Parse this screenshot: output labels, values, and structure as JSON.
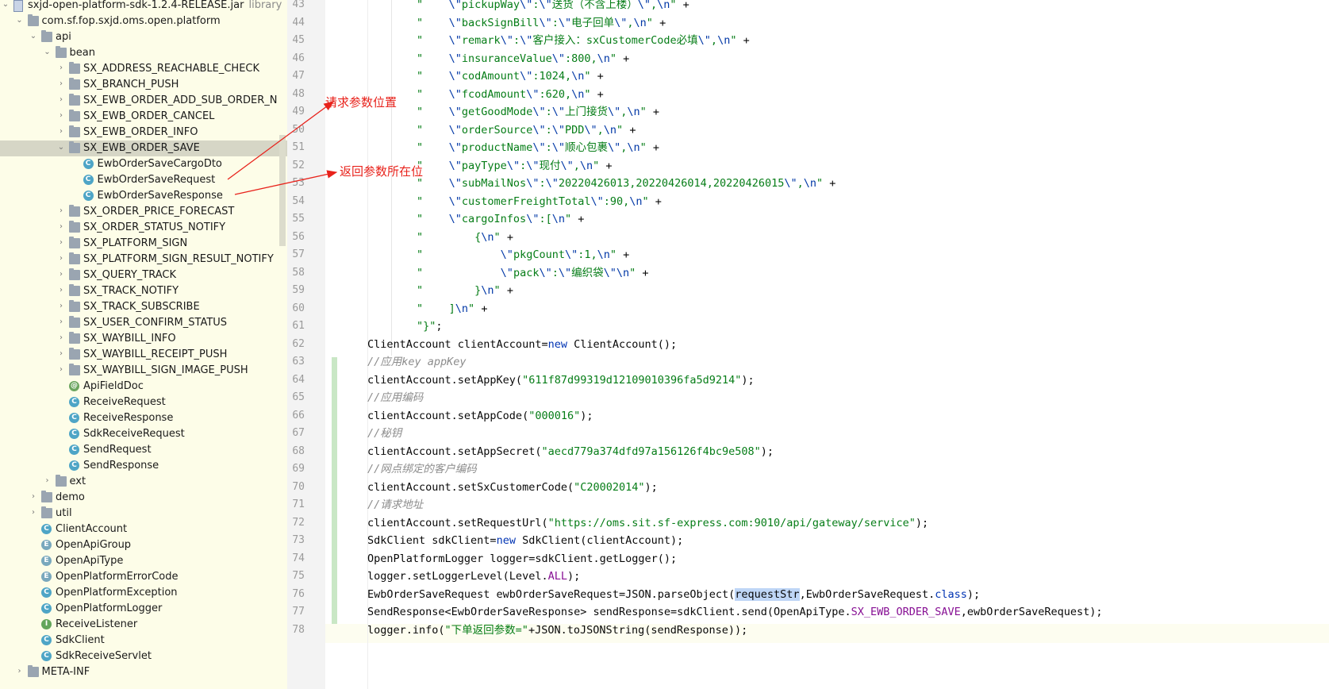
{
  "tree": {
    "rows": [
      {
        "depth": 2,
        "expanded": true,
        "icon": "jar",
        "label": "sxjd-open-platform-sdk-1.2.4-RELEASE.jar",
        "suffix": "library"
      },
      {
        "depth": 3,
        "expanded": true,
        "icon": "folder",
        "label": "com.sf.fop.sxjd.oms.open.platform"
      },
      {
        "depth": 4,
        "expanded": true,
        "icon": "folder",
        "label": "api"
      },
      {
        "depth": 5,
        "expanded": true,
        "icon": "folder",
        "label": "bean"
      },
      {
        "depth": 6,
        "expanded": false,
        "icon": "folder",
        "label": "SX_ADDRESS_REACHABLE_CHECK"
      },
      {
        "depth": 6,
        "expanded": false,
        "icon": "folder",
        "label": "SX_BRANCH_PUSH"
      },
      {
        "depth": 6,
        "expanded": false,
        "icon": "folder",
        "label": "SX_EWB_ORDER_ADD_SUB_ORDER_N"
      },
      {
        "depth": 6,
        "expanded": false,
        "icon": "folder",
        "label": "SX_EWB_ORDER_CANCEL"
      },
      {
        "depth": 6,
        "expanded": false,
        "icon": "folder",
        "label": "SX_EWB_ORDER_INFO"
      },
      {
        "depth": 6,
        "expanded": true,
        "icon": "folder",
        "label": "SX_EWB_ORDER_SAVE",
        "selected": true
      },
      {
        "depth": 7,
        "icon": "c",
        "label": "EwbOrderSaveCargoDto"
      },
      {
        "depth": 7,
        "icon": "c",
        "label": "EwbOrderSaveRequest"
      },
      {
        "depth": 7,
        "icon": "c",
        "label": "EwbOrderSaveResponse"
      },
      {
        "depth": 6,
        "expanded": false,
        "icon": "folder",
        "label": "SX_ORDER_PRICE_FORECAST"
      },
      {
        "depth": 6,
        "expanded": false,
        "icon": "folder",
        "label": "SX_ORDER_STATUS_NOTIFY"
      },
      {
        "depth": 6,
        "expanded": false,
        "icon": "folder",
        "label": "SX_PLATFORM_SIGN"
      },
      {
        "depth": 6,
        "expanded": false,
        "icon": "folder",
        "label": "SX_PLATFORM_SIGN_RESULT_NOTIFY"
      },
      {
        "depth": 6,
        "expanded": false,
        "icon": "folder",
        "label": "SX_QUERY_TRACK"
      },
      {
        "depth": 6,
        "expanded": false,
        "icon": "folder",
        "label": "SX_TRACK_NOTIFY"
      },
      {
        "depth": 6,
        "expanded": false,
        "icon": "folder",
        "label": "SX_TRACK_SUBSCRIBE"
      },
      {
        "depth": 6,
        "expanded": false,
        "icon": "folder",
        "label": "SX_USER_CONFIRM_STATUS"
      },
      {
        "depth": 6,
        "expanded": false,
        "icon": "folder",
        "label": "SX_WAYBILL_INFO"
      },
      {
        "depth": 6,
        "expanded": false,
        "icon": "folder",
        "label": "SX_WAYBILL_RECEIPT_PUSH"
      },
      {
        "depth": 6,
        "expanded": false,
        "icon": "folder",
        "label": "SX_WAYBILL_SIGN_IMAGE_PUSH"
      },
      {
        "depth": 6,
        "icon": "at",
        "label": "ApiFieldDoc"
      },
      {
        "depth": 6,
        "icon": "c",
        "label": "ReceiveRequest"
      },
      {
        "depth": 6,
        "icon": "c",
        "label": "ReceiveResponse"
      },
      {
        "depth": 6,
        "icon": "c",
        "label": "SdkReceiveRequest"
      },
      {
        "depth": 6,
        "icon": "c",
        "label": "SendRequest"
      },
      {
        "depth": 6,
        "icon": "c",
        "label": "SendResponse"
      },
      {
        "depth": 5,
        "expanded": false,
        "icon": "folder",
        "label": "ext"
      },
      {
        "depth": 4,
        "expanded": false,
        "icon": "folder",
        "label": "demo"
      },
      {
        "depth": 4,
        "expanded": false,
        "icon": "folder",
        "label": "util"
      },
      {
        "depth": 4,
        "icon": "c",
        "label": "ClientAccount"
      },
      {
        "depth": 4,
        "icon": "e",
        "label": "OpenApiGroup"
      },
      {
        "depth": 4,
        "icon": "e",
        "label": "OpenApiType"
      },
      {
        "depth": 4,
        "icon": "e",
        "label": "OpenPlatformErrorCode"
      },
      {
        "depth": 4,
        "icon": "c",
        "label": "OpenPlatformException"
      },
      {
        "depth": 4,
        "icon": "c",
        "label": "OpenPlatformLogger"
      },
      {
        "depth": 4,
        "icon": "i",
        "label": "ReceiveListener"
      },
      {
        "depth": 4,
        "icon": "c",
        "label": "SdkClient"
      },
      {
        "depth": 4,
        "icon": "c",
        "label": "SdkReceiveServlet"
      },
      {
        "depth": 3,
        "expanded": false,
        "icon": "folder",
        "label": "META-INF"
      }
    ]
  },
  "gutter": {
    "line_numbers": [
      "43",
      "44",
      "45",
      "46",
      "47",
      "48",
      "49",
      "50",
      "51",
      "52",
      "53",
      "54",
      "55",
      "56",
      "57",
      "58",
      "59",
      "60",
      "61",
      "62",
      "63",
      "64",
      "65",
      "66",
      "67",
      "68",
      "69",
      "70",
      "71",
      "72",
      "73",
      "74",
      "75",
      "76",
      "77",
      "78"
    ]
  },
  "editor": {
    "lines": [
      [
        [
          "s",
          "\"    "
        ],
        [
          "esc",
          "\\\""
        ],
        [
          "s",
          "pickupWay"
        ],
        [
          "esc",
          "\\\""
        ],
        [
          "s",
          ":"
        ],
        [
          "esc",
          "\\\""
        ],
        [
          "s",
          "送货（不含上楼）"
        ],
        [
          "esc",
          "\\\""
        ],
        [
          "s",
          ","
        ],
        [
          "esc",
          "\\n"
        ],
        [
          "s",
          "\""
        ],
        [
          "p",
          " +"
        ]
      ],
      [
        [
          "s",
          "\"    "
        ],
        [
          "esc",
          "\\\""
        ],
        [
          "s",
          "backSignBill"
        ],
        [
          "esc",
          "\\\""
        ],
        [
          "s",
          ":"
        ],
        [
          "esc",
          "\\\""
        ],
        [
          "s",
          "电子回单"
        ],
        [
          "esc",
          "\\\""
        ],
        [
          "s",
          ","
        ],
        [
          "esc",
          "\\n"
        ],
        [
          "s",
          "\""
        ],
        [
          "p",
          " +"
        ]
      ],
      [
        [
          "s",
          "\"    "
        ],
        [
          "esc",
          "\\\""
        ],
        [
          "s",
          "remark"
        ],
        [
          "esc",
          "\\\""
        ],
        [
          "s",
          ":"
        ],
        [
          "esc",
          "\\\""
        ],
        [
          "s",
          "客户接入：sxCustomerCode必填"
        ],
        [
          "esc",
          "\\\""
        ],
        [
          "s",
          ","
        ],
        [
          "esc",
          "\\n"
        ],
        [
          "s",
          "\""
        ],
        [
          "p",
          " +"
        ]
      ],
      [
        [
          "s",
          "\"    "
        ],
        [
          "esc",
          "\\\""
        ],
        [
          "s",
          "insuranceValue"
        ],
        [
          "esc",
          "\\\""
        ],
        [
          "s",
          ":800,"
        ],
        [
          "esc",
          "\\n"
        ],
        [
          "s",
          "\""
        ],
        [
          "p",
          " +"
        ]
      ],
      [
        [
          "s",
          "\"    "
        ],
        [
          "esc",
          "\\\""
        ],
        [
          "s",
          "codAmount"
        ],
        [
          "esc",
          "\\\""
        ],
        [
          "s",
          ":1024,"
        ],
        [
          "esc",
          "\\n"
        ],
        [
          "s",
          "\""
        ],
        [
          "p",
          " +"
        ]
      ],
      [
        [
          "s",
          "\"    "
        ],
        [
          "esc",
          "\\\""
        ],
        [
          "s",
          "fcodAmount"
        ],
        [
          "esc",
          "\\\""
        ],
        [
          "s",
          ":620,"
        ],
        [
          "esc",
          "\\n"
        ],
        [
          "s",
          "\""
        ],
        [
          "p",
          " +"
        ]
      ],
      [
        [
          "s",
          "\"    "
        ],
        [
          "esc",
          "\\\""
        ],
        [
          "s",
          "getGoodMode"
        ],
        [
          "esc",
          "\\\""
        ],
        [
          "s",
          ":"
        ],
        [
          "esc",
          "\\\""
        ],
        [
          "s",
          "上门接货"
        ],
        [
          "esc",
          "\\\""
        ],
        [
          "s",
          ","
        ],
        [
          "esc",
          "\\n"
        ],
        [
          "s",
          "\""
        ],
        [
          "p",
          " +"
        ]
      ],
      [
        [
          "s",
          "\"    "
        ],
        [
          "esc",
          "\\\""
        ],
        [
          "s",
          "orderSource"
        ],
        [
          "esc",
          "\\\""
        ],
        [
          "s",
          ":"
        ],
        [
          "esc",
          "\\\""
        ],
        [
          "s",
          "PDD"
        ],
        [
          "esc",
          "\\\""
        ],
        [
          "s",
          ","
        ],
        [
          "esc",
          "\\n"
        ],
        [
          "s",
          "\""
        ],
        [
          "p",
          " +"
        ]
      ],
      [
        [
          "s",
          "\"    "
        ],
        [
          "esc",
          "\\\""
        ],
        [
          "s",
          "productName"
        ],
        [
          "esc",
          "\\\""
        ],
        [
          "s",
          ":"
        ],
        [
          "esc",
          "\\\""
        ],
        [
          "s",
          "顺心包裹"
        ],
        [
          "esc",
          "\\\""
        ],
        [
          "s",
          ","
        ],
        [
          "esc",
          "\\n"
        ],
        [
          "s",
          "\""
        ],
        [
          "p",
          " +"
        ]
      ],
      [
        [
          "s",
          "\"    "
        ],
        [
          "esc",
          "\\\""
        ],
        [
          "s",
          "payType"
        ],
        [
          "esc",
          "\\\""
        ],
        [
          "s",
          ":"
        ],
        [
          "esc",
          "\\\""
        ],
        [
          "s",
          "现付"
        ],
        [
          "esc",
          "\\\""
        ],
        [
          "s",
          ","
        ],
        [
          "esc",
          "\\n"
        ],
        [
          "s",
          "\""
        ],
        [
          "p",
          " +"
        ]
      ],
      [
        [
          "s",
          "\"    "
        ],
        [
          "esc",
          "\\\""
        ],
        [
          "s",
          "subMailNos"
        ],
        [
          "esc",
          "\\\""
        ],
        [
          "s",
          ":"
        ],
        [
          "esc",
          "\\\""
        ],
        [
          "s",
          "20220426013,20220426014,20220426015"
        ],
        [
          "esc",
          "\\\""
        ],
        [
          "s",
          ","
        ],
        [
          "esc",
          "\\n"
        ],
        [
          "s",
          "\""
        ],
        [
          "p",
          " +"
        ]
      ],
      [
        [
          "s",
          "\"    "
        ],
        [
          "esc",
          "\\\""
        ],
        [
          "s",
          "customerFreightTotal"
        ],
        [
          "esc",
          "\\\""
        ],
        [
          "s",
          ":90,"
        ],
        [
          "esc",
          "\\n"
        ],
        [
          "s",
          "\""
        ],
        [
          "p",
          " +"
        ]
      ],
      [
        [
          "s",
          "\"    "
        ],
        [
          "esc",
          "\\\""
        ],
        [
          "s",
          "cargoInfos"
        ],
        [
          "esc",
          "\\\""
        ],
        [
          "s",
          ":["
        ],
        [
          "esc",
          "\\n"
        ],
        [
          "s",
          "\""
        ],
        [
          "p",
          " +"
        ]
      ],
      [
        [
          "s",
          "\"        {"
        ],
        [
          "esc",
          "\\n"
        ],
        [
          "s",
          "\""
        ],
        [
          "p",
          " +"
        ]
      ],
      [
        [
          "s",
          "\"            "
        ],
        [
          "esc",
          "\\\""
        ],
        [
          "s",
          "pkgCount"
        ],
        [
          "esc",
          "\\\""
        ],
        [
          "s",
          ":1,"
        ],
        [
          "esc",
          "\\n"
        ],
        [
          "s",
          "\""
        ],
        [
          "p",
          " +"
        ]
      ],
      [
        [
          "s",
          "\"            "
        ],
        [
          "esc",
          "\\\""
        ],
        [
          "s",
          "pack"
        ],
        [
          "esc",
          "\\\""
        ],
        [
          "s",
          ":"
        ],
        [
          "esc",
          "\\\""
        ],
        [
          "s",
          "编织袋"
        ],
        [
          "esc",
          "\\\""
        ],
        [
          "esc",
          "\\n"
        ],
        [
          "s",
          "\""
        ],
        [
          "p",
          " +"
        ]
      ],
      [
        [
          "s",
          "\"        }"
        ],
        [
          "esc",
          "\\n"
        ],
        [
          "s",
          "\""
        ],
        [
          "p",
          " +"
        ]
      ],
      [
        [
          "s",
          "\"    ]"
        ],
        [
          "esc",
          "\\n"
        ],
        [
          "s",
          "\""
        ],
        [
          "p",
          " +"
        ]
      ],
      [
        [
          "s",
          "\"}\""
        ],
        [
          "p",
          ";"
        ]
      ],
      [
        [
          "p",
          "ClientAccount clientAccount="
        ],
        [
          "kw",
          "new"
        ],
        [
          "p",
          " ClientAccount();"
        ]
      ],
      [
        [
          "cm",
          "//应用key appKey"
        ]
      ],
      [
        [
          "p",
          "clientAccount.setAppKey("
        ],
        [
          "s",
          "\"611f87d99319d12109010396fa5d9214\""
        ],
        [
          "p",
          ");"
        ]
      ],
      [
        [
          "cm",
          "//应用编码"
        ]
      ],
      [
        [
          "p",
          "clientAccount.setAppCode("
        ],
        [
          "s",
          "\"000016\""
        ],
        [
          "p",
          ");"
        ]
      ],
      [
        [
          "cm",
          "//秘钥"
        ]
      ],
      [
        [
          "p",
          "clientAccount.setAppSecret("
        ],
        [
          "s",
          "\"aecd779a374dfd97a156126f4bc9e508\""
        ],
        [
          "p",
          ");"
        ]
      ],
      [
        [
          "cm",
          "//网点绑定的客户编码"
        ]
      ],
      [
        [
          "p",
          "clientAccount.setSxCustomerCode("
        ],
        [
          "s",
          "\"C20002014\""
        ],
        [
          "p",
          ");"
        ]
      ],
      [
        [
          "cm",
          "//请求地址"
        ]
      ],
      [
        [
          "p",
          "clientAccount.setRequestUrl("
        ],
        [
          "s",
          "\"https://oms.sit.sf-express.com:9010/api/gateway/service\""
        ],
        [
          "p",
          ");"
        ]
      ],
      [
        [
          "p",
          "SdkClient sdkClient="
        ],
        [
          "kw",
          "new"
        ],
        [
          "p",
          " SdkClient(clientAccount);"
        ]
      ],
      [
        [
          "p",
          "OpenPlatformLogger logger=sdkClient.getLogger();"
        ]
      ],
      [
        [
          "p",
          "logger.setLoggerLevel(Level."
        ],
        [
          "fld",
          "ALL"
        ],
        [
          "p",
          ");"
        ]
      ],
      [
        [
          "p",
          "EwbOrderSaveRequest ewbOrderSaveRequest=JSON.parseObject("
        ],
        [
          "hl",
          "requestStr"
        ],
        [
          "p",
          ",EwbOrderSaveRequest."
        ],
        [
          "kw",
          "class"
        ],
        [
          "p",
          ");"
        ]
      ],
      [
        [
          "p",
          "SendResponse<EwbOrderSaveResponse> sendResponse=sdkClient.send(OpenApiType."
        ],
        [
          "fld",
          "SX_EWB_ORDER_SAVE"
        ],
        [
          "p",
          ",ewbOrderSaveRequest);"
        ]
      ],
      [
        [
          "p",
          "logger.info("
        ],
        [
          "s",
          "\"下单返回参数=\""
        ],
        [
          "p",
          "+JSON.toJSONString(sendResponse));"
        ]
      ]
    ]
  },
  "annotations": {
    "request_label": "请求参数位置",
    "response_label": "返回参数所在位",
    "color": "#e8221b"
  }
}
